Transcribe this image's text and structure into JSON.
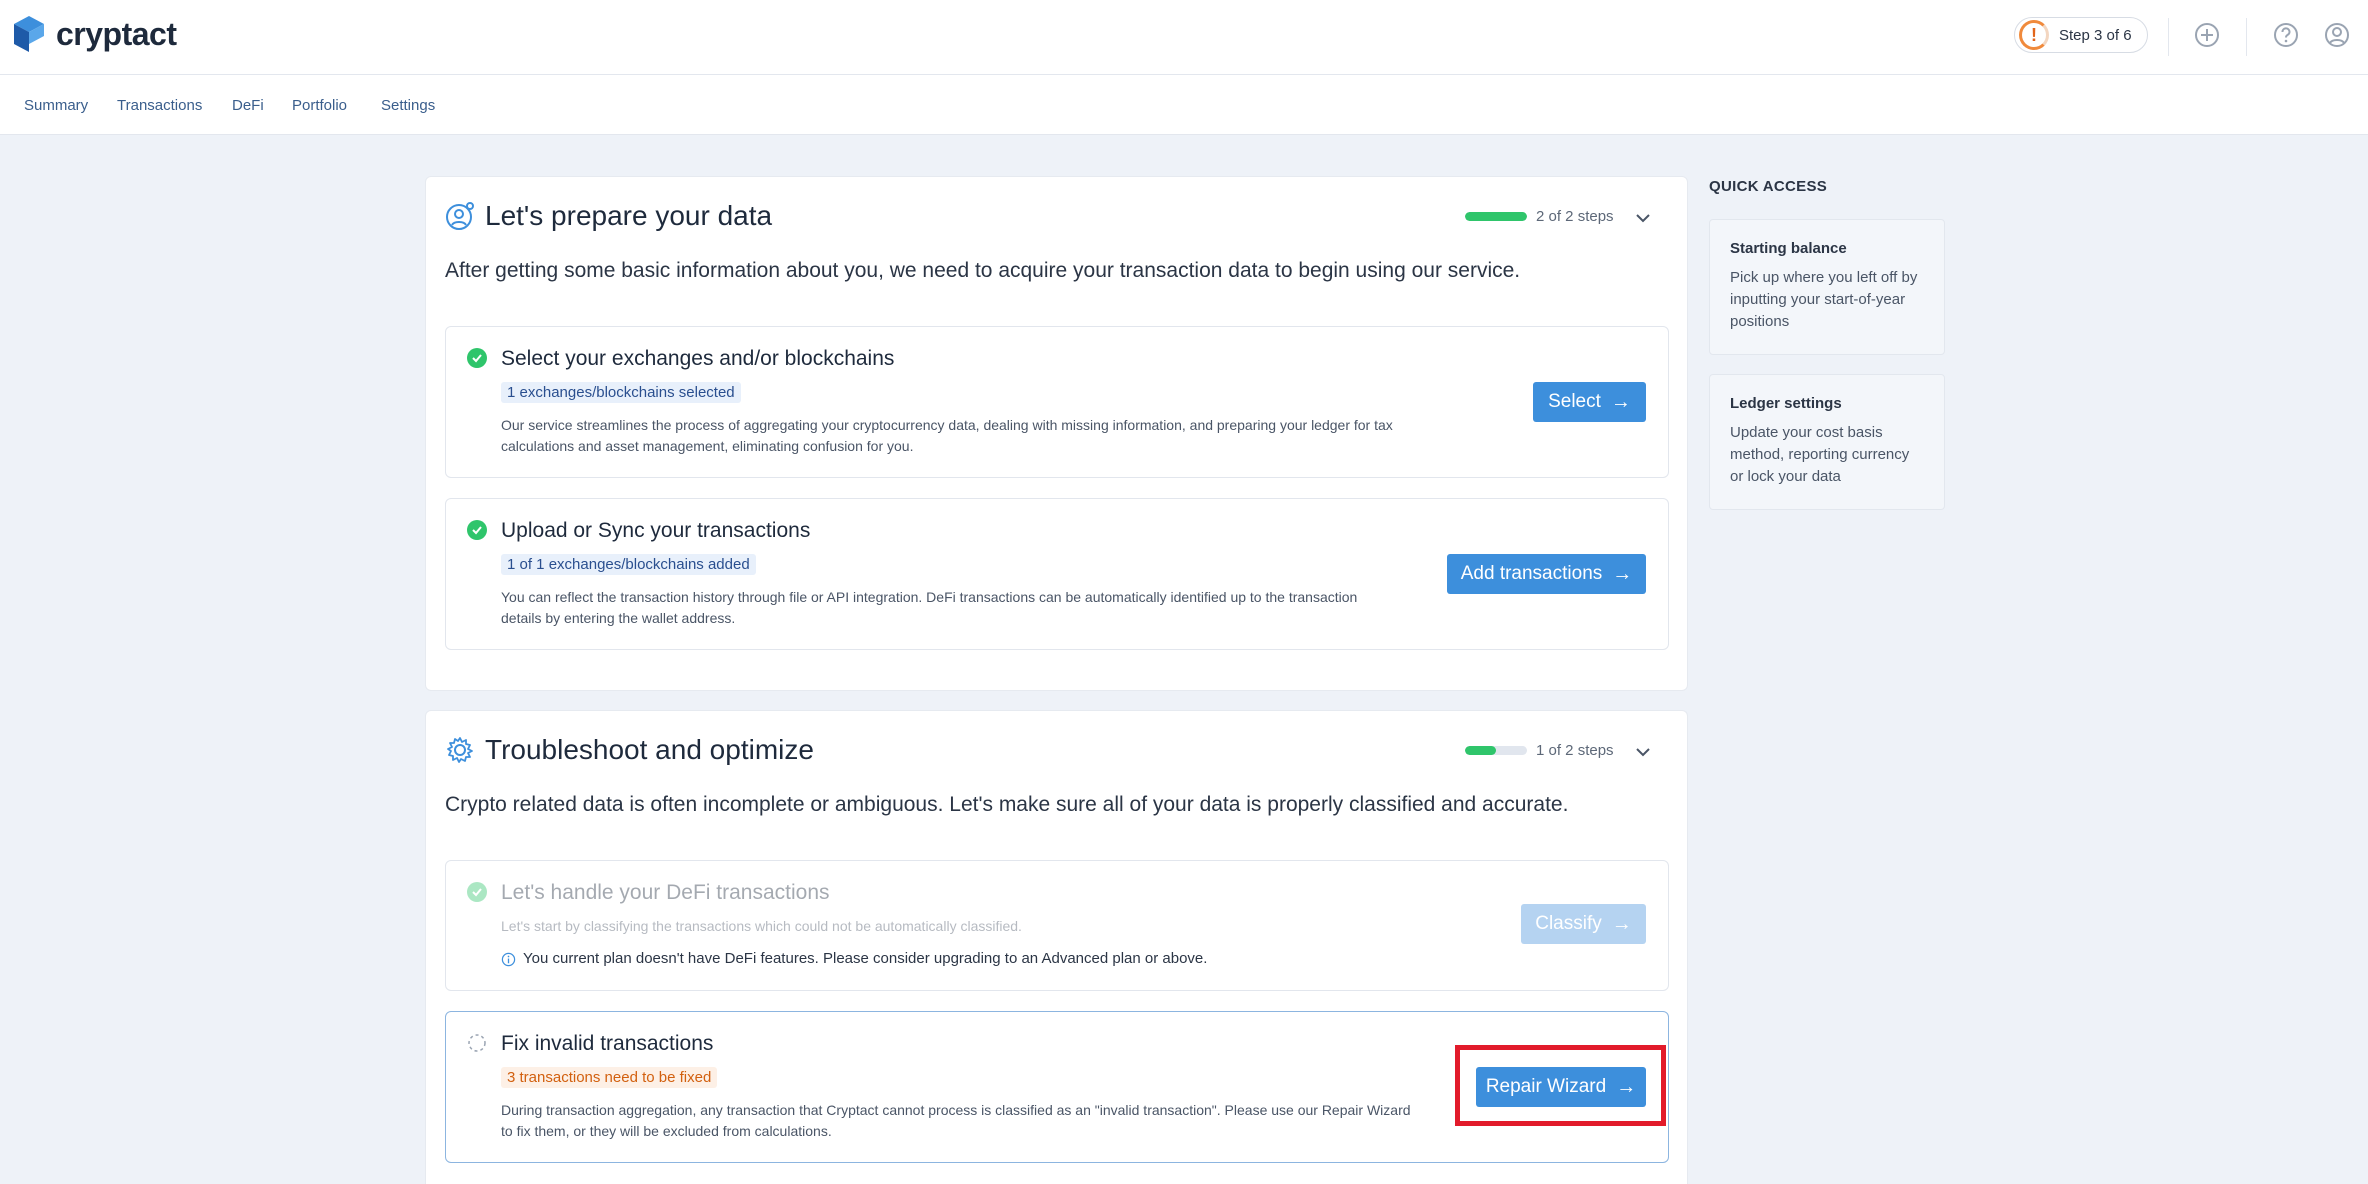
{
  "header": {
    "brand": "cryptact",
    "step_indicator": "Step 3 of 6",
    "step_icon_glyph": "!",
    "icons": [
      "plus-circle-icon",
      "help-circle-icon",
      "user-circle-icon"
    ]
  },
  "nav": {
    "items": [
      {
        "label": "Summary"
      },
      {
        "label": "Transactions"
      },
      {
        "label": "DeFi"
      },
      {
        "label": "Portfolio"
      },
      {
        "label": "Settings"
      }
    ]
  },
  "prepare": {
    "title": "Let's prepare your data",
    "progress_label": "2 of 2 steps",
    "progress_fraction": 1.0,
    "description": "After getting some basic information about you, we need to acquire your transaction data to begin using our service.",
    "steps": [
      {
        "title": "Select your exchanges and/or blockchains",
        "badge": "1 exchanges/blockchains selected",
        "description": "Our service streamlines the process of aggregating your cryptocurrency data, dealing with missing information, and preparing your ledger for tax calculations and asset management, eliminating confusion for you.",
        "button": "Select",
        "status": "done"
      },
      {
        "title": "Upload or Sync your transactions",
        "badge": "1 of 1 exchanges/blockchains added",
        "description": "You can reflect the transaction history through file or API integration. DeFi transactions can be automatically identified up to the transaction details by entering the wallet address.",
        "button": "Add transactions",
        "status": "done"
      }
    ]
  },
  "troubleshoot": {
    "title": "Troubleshoot and optimize",
    "progress_label": "1 of 2 steps",
    "progress_fraction": 0.5,
    "description": "Crypto related data is often incomplete or ambiguous. Let's make sure all of your data is properly classified and accurate.",
    "steps": [
      {
        "title": "Let's handle your DeFi transactions",
        "description": "Let's start by classifying the transactions which could not be automatically classified.",
        "notice": "You current plan doesn't have DeFi features. Please consider upgrading to an Advanced plan or above.",
        "button": "Classify",
        "status": "disabled"
      },
      {
        "title": "Fix invalid transactions",
        "badge": "3 transactions need to be fixed",
        "description": "During transaction aggregation, any transaction that Cryptact cannot process is classified as an \"invalid transaction\". Please use our Repair Wizard to fix them, or they will be excluded from calculations.",
        "button": "Repair Wizard",
        "status": "pending"
      }
    ]
  },
  "quick_access": {
    "title": "QUICK ACCESS",
    "cards": [
      {
        "heading": "Starting balance",
        "body": "Pick up where you left off by inputting your start-of-year positions"
      },
      {
        "heading": "Ledger settings",
        "body": "Update your cost basis method, reporting currency or lock your data"
      }
    ]
  },
  "colors": {
    "accent": "#3d8fdc",
    "success": "#2fc56b",
    "warning": "#d2600f",
    "highlight": "#e21b2b"
  }
}
